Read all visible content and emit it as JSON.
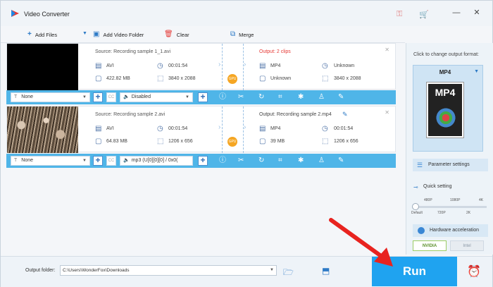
{
  "app": {
    "title": "Video Converter"
  },
  "toolbar": {
    "add_files": "Add Files",
    "add_video_folder": "Add Video Folder",
    "clear": "Clear",
    "merge": "Merge"
  },
  "rows": [
    {
      "source_title": "Source: Recording sample 1_1.avi",
      "output_title": "Output: 2 clips",
      "output_color": "#e53935",
      "src_format": "AVI",
      "src_duration": "00:01:54",
      "src_size": "422.82 MB",
      "src_resolution": "3840 x 2088",
      "out_format": "MP4",
      "out_duration": "Unknown",
      "out_size": "Unknown",
      "out_resolution": "3840 x 2088",
      "subtitle": "None",
      "audio": "Disabled"
    },
    {
      "source_title": "Source: Recording sample 2.avi",
      "output_title": "Output: Recording sample 2.mp4",
      "output_color": "#444444",
      "src_format": "AVI",
      "src_duration": "00:01:54",
      "src_size": "64.83 MB",
      "src_resolution": "1206 x 656",
      "out_format": "MP4",
      "out_duration": "00:01:54",
      "out_size": "39 MB",
      "out_resolution": "1206 x 656",
      "subtitle": "None",
      "audio": "mp3 (U[0][0][0] / 0x0("
    }
  ],
  "gpu_label": "GPU",
  "right_panel": {
    "change_label": "Click to change output format:",
    "format": "MP4",
    "format_badge": "MP4",
    "parameter_settings": "Parameter settings",
    "quick_setting": "Quick setting",
    "ticks_top": [
      "480P",
      "1080P",
      "4K"
    ],
    "ticks_bottom": [
      "Default",
      "720P",
      "2K"
    ],
    "hardware_acceleration": "Hardware acceleration",
    "nvidia": "NVIDIA",
    "intel": "Intel"
  },
  "bottom": {
    "output_folder_label": "Output folder:",
    "output_folder_path": "C:\\Users\\WonderFox\\Downloads",
    "run": "Run"
  },
  "colors": {
    "accent": "#4fb5e8",
    "run": "#1fa3f0",
    "annotation": "#e8231f"
  }
}
